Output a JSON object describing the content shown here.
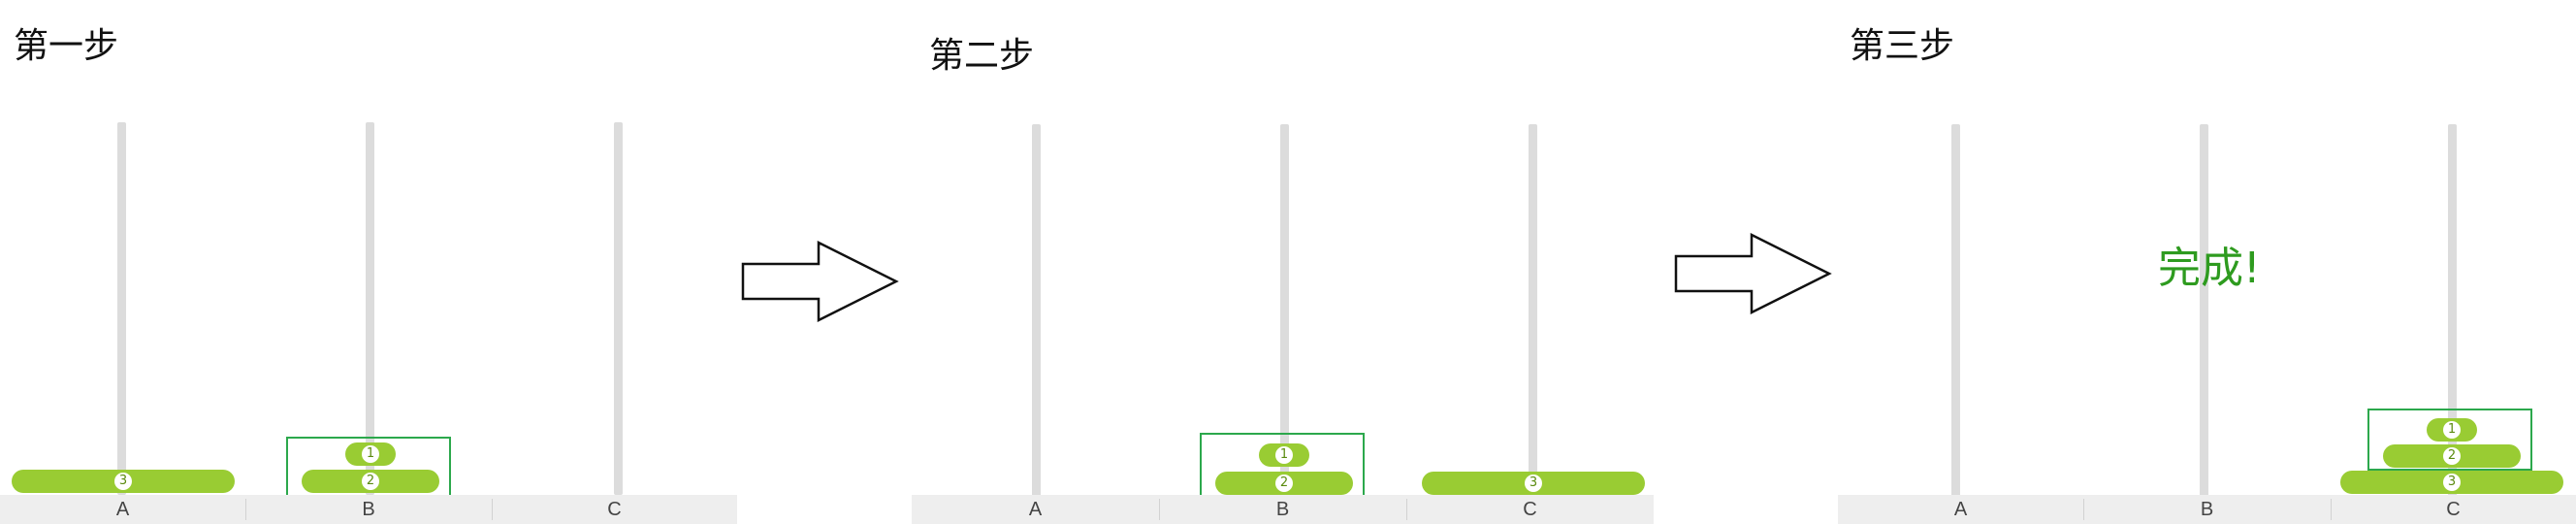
{
  "steps": [
    {
      "title": "第一步",
      "rods": [
        "A",
        "B",
        "C"
      ],
      "disks": [
        {
          "number": "3",
          "rod": "A"
        },
        {
          "number": "1",
          "rod": "B"
        },
        {
          "number": "2",
          "rod": "B"
        }
      ]
    },
    {
      "title": "第二步",
      "rods": [
        "A",
        "B",
        "C"
      ],
      "disks": [
        {
          "number": "1",
          "rod": "B"
        },
        {
          "number": "2",
          "rod": "B"
        },
        {
          "number": "3",
          "rod": "C"
        }
      ]
    },
    {
      "title": "第三步",
      "rods": [
        "A",
        "B",
        "C"
      ],
      "status": "完成!",
      "disks": [
        {
          "number": "1",
          "rod": "C"
        },
        {
          "number": "2",
          "rod": "C"
        },
        {
          "number": "3",
          "rod": "C"
        }
      ]
    }
  ],
  "colors": {
    "disk": "#99cc33",
    "rod": "#dcdcdc",
    "highlight": "#2ca84c",
    "status_text": "#2e9b1f"
  }
}
